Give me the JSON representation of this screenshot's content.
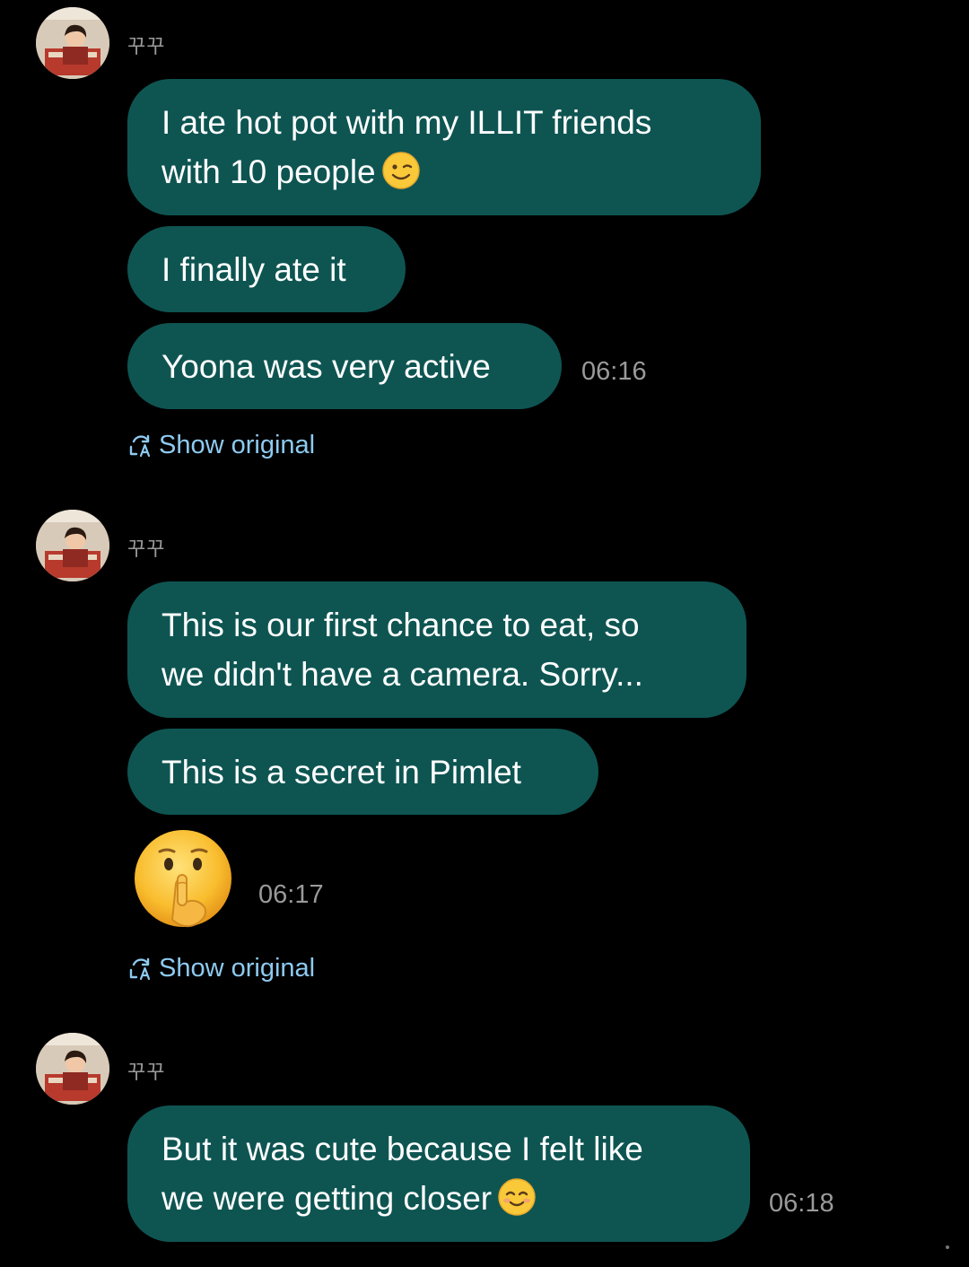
{
  "conversation": {
    "groups": [
      {
        "sender": "꾸꾸",
        "messages": [
          {
            "text": "I ate hot pot with my ILLIT friends\nwith 10 people",
            "emoji": "winking-face-emoji"
          },
          {
            "text": "I finally ate it"
          },
          {
            "text": "Yoona was very active",
            "time": "06:16"
          }
        ],
        "show_original": "Show original"
      },
      {
        "sender": "꾸꾸",
        "messages": [
          {
            "text": "This is our first chance to eat, so\nwe didn't have a camera. Sorry..."
          },
          {
            "text": "This is a secret in Pimlet"
          },
          {
            "emoji": "shushing-face-emoji",
            "time": "06:17"
          }
        ],
        "show_original": "Show original"
      },
      {
        "sender": "꾸꾸",
        "messages": [
          {
            "text": "But it was cute because I felt like\nwe were getting closer",
            "emoji": "smiling-face-emoji",
            "time": "06:18"
          }
        ]
      }
    ]
  },
  "colors": {
    "background": "#000000",
    "bubble": "#0e5552",
    "timestamp": "#9a9a9a",
    "link": "#8ecaf0"
  }
}
